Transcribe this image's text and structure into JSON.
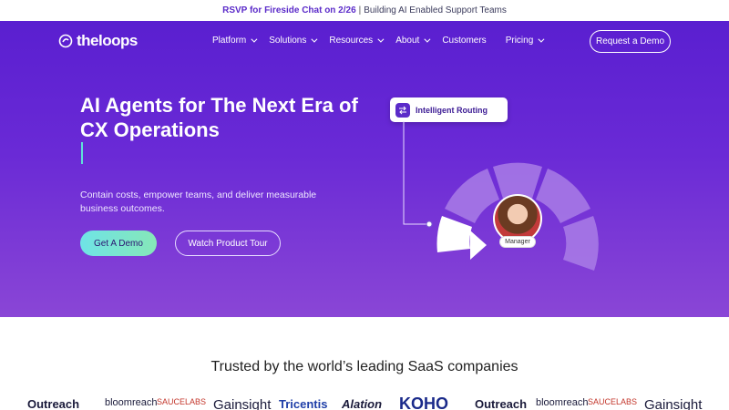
{
  "announcement": {
    "rsvp": "RSVP for Fireside Chat on 2/26",
    "separator": "|",
    "topic": "Building AI Enabled Support Teams"
  },
  "nav": {
    "logo_text": "theloops",
    "items": [
      {
        "label": "Platform",
        "has_caret": true
      },
      {
        "label": "Solutions",
        "has_caret": true
      },
      {
        "label": "Resources",
        "has_caret": true
      },
      {
        "label": "About",
        "has_caret": true
      },
      {
        "label": "Customers",
        "has_caret": false
      },
      {
        "label": "Pricing",
        "has_caret": true
      }
    ],
    "demo_button": "Request a Demo"
  },
  "hero": {
    "headline": "AI Agents for The Next Era of CX Operations",
    "subtext": "Contain costs, empower teams, and deliver measurable business outcomes.",
    "primary_button": "Get A Demo",
    "secondary_button": "Watch Product Tour"
  },
  "illustration": {
    "routing_label": "Intelligent Routing",
    "manager_label": "Manager"
  },
  "trusted": {
    "heading": "Trusted by the world’s leading SaaS companies",
    "logos": [
      "Outreach",
      "bloomreach",
      "SAUCELABS",
      "Gainsight",
      "Tricentis",
      "Alation",
      "KOHO",
      "Outreach",
      "bloomreach",
      "SAUCELABS",
      "Gainsight"
    ]
  },
  "colors": {
    "hero_top": "#5a1fd0",
    "hero_bottom": "#8a46d6",
    "accent_teal": "#6fe3e6",
    "accent_purple": "#5b2bc9"
  }
}
